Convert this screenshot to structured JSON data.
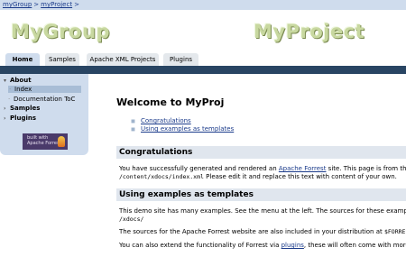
{
  "breadcrumb": {
    "items": [
      "myGroup",
      "myProject"
    ],
    "separator": ">"
  },
  "header": {
    "group_logo": "MyGroup",
    "project_logo": "MyProject"
  },
  "tabs": [
    {
      "label": "Home",
      "active": true
    },
    {
      "label": "Samples",
      "active": false
    },
    {
      "label": "Apache XML Projects",
      "active": false
    },
    {
      "label": "Plugins",
      "active": false
    }
  ],
  "sidebar": {
    "about": "About",
    "index": "Index",
    "doc_toc": "Documentation ToC",
    "samples": "Samples",
    "plugins": "Plugins",
    "badge_line1": "built with",
    "badge_line2": "Apache Forrest"
  },
  "main": {
    "title": "Welcome to MyProj",
    "toc": [
      "Congratulations",
      "Using examples as templates"
    ],
    "sec1_title": "Congratulations",
    "sec1_p1_a": "You have successfully generated and rendered an ",
    "sec1_p1_link": "Apache Forrest",
    "sec1_p1_b": " site. This page is from the si",
    "sec1_p2_code": "/content/xdocs/index.xml",
    "sec1_p2_b": " Please edit it and replace this text with content of your own.",
    "sec2_title": "Using examples as templates",
    "sec2_p1": "This demo site has many examples. See the menu at the left. The sources for these examples a",
    "sec2_p1_code": "/xdocs/",
    "sec2_p2_a": "The sources for the Apache Forrest website are also included in your distribution at ",
    "sec2_p2_code": "$FORREST_",
    "sec2_p3_a": "You can also extend the functionality of Forrest via ",
    "sec2_p3_link": "plugins",
    "sec2_p3_b": ", these will often come with more sa"
  },
  "colors": {
    "accent_bar": "#294563",
    "nav_bg": "#cfdced",
    "link": "#1a3a8a"
  }
}
